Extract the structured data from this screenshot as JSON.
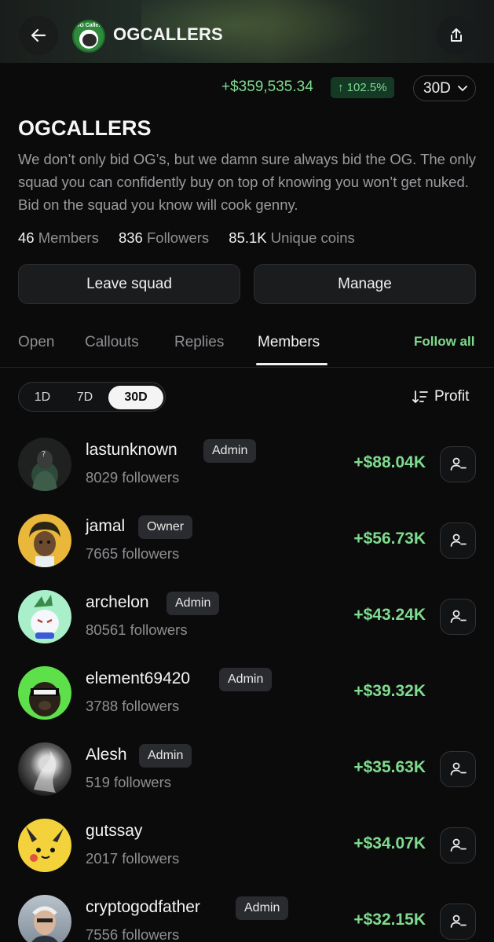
{
  "header": {
    "brand": "OGCALLERS",
    "logo_text": "OG Callers"
  },
  "stats": {
    "pnl": "+$359,535.34",
    "pnl_pct": "↑ 102.5%",
    "range": "30D"
  },
  "squad": {
    "title": "OGCALLERS",
    "description": "We don’t only bid OG’s, but we damn sure always bid the OG. The only squad you can confidently buy on top of knowing you won’t get nuked. Bid on the squad you know will cook genny.",
    "members_count": "46",
    "members_label": "Members",
    "followers_count": "836",
    "followers_label": "Followers",
    "coins_count": "85.1K",
    "coins_label": "Unique coins"
  },
  "actions": {
    "leave": "Leave squad",
    "manage": "Manage"
  },
  "tabs": [
    {
      "label": "Open"
    },
    {
      "label": "Callouts"
    },
    {
      "label": "Replies"
    },
    {
      "label": "Members"
    }
  ],
  "active_tab": "Members",
  "follow_all": "Follow all",
  "period": {
    "options": [
      "1D",
      "7D",
      "30D"
    ],
    "selected": "30D"
  },
  "sort_label": "Profit",
  "members": [
    {
      "name": "lastunknown",
      "badge": "Admin",
      "followers": "8029 followers",
      "profit": "+$88.04K",
      "follow_button": true
    },
    {
      "name": "jamal",
      "badge": "Owner",
      "followers": "7665 followers",
      "profit": "+$56.73K",
      "follow_button": true
    },
    {
      "name": "archelon",
      "badge": "Admin",
      "followers": "80561 followers",
      "profit": "+$43.24K",
      "follow_button": true
    },
    {
      "name": "element69420",
      "badge": "Admin",
      "followers": "3788 followers",
      "profit": "+$39.32K",
      "follow_button": false
    },
    {
      "name": "Alesh",
      "badge": "Admin",
      "followers": "519 followers",
      "profit": "+$35.63K",
      "follow_button": true
    },
    {
      "name": "gutssay",
      "badge": "",
      "followers": "2017 followers",
      "profit": "+$34.07K",
      "follow_button": true
    },
    {
      "name": "cryptogodfather",
      "badge": "Admin",
      "followers": "7556 followers",
      "profit": "+$32.15K",
      "follow_button": true
    }
  ],
  "colors": {
    "accent_green": "#7fdb8e",
    "background": "#0b0b0c",
    "badge_bg": "#2a2b2e"
  }
}
